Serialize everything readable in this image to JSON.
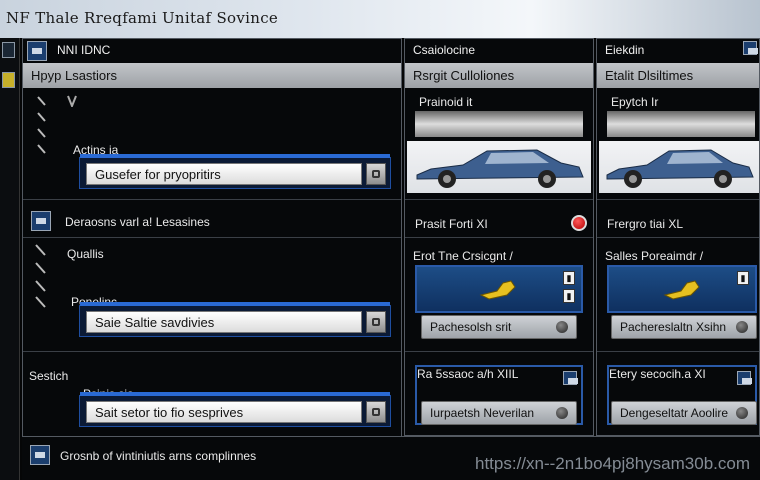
{
  "window": {
    "title": "NF Thale Rreqfami Unitaf Sovince"
  },
  "left_panel": {
    "header": "NNI IDNC",
    "subheader": "Hpyp Lsastiors",
    "section1": {
      "label": "Actins ia",
      "input_value": "Gusefer for pryopritirs"
    },
    "section2": {
      "label": "Deraosns varl a! Lesasines"
    },
    "section3": {
      "label": "Quallis",
      "sublabel": "Ponelinc",
      "input_value": "Saie Saltie savdivies"
    },
    "section4": {
      "label": "Sestich",
      "sublabel": "Psinis sia",
      "input_value": "Sait setor tio fio sesprives"
    },
    "footer": "Grosnb of vintiniutis arns complinnes"
  },
  "mid_panel": {
    "header": "Csaiolocine",
    "subheader": "Rsrgit Culloliones",
    "car_label": "Prainoid it",
    "row2_label": "Prasit Forti XI",
    "row3_label": "Erot Tne Crsicgnt /",
    "pill1": "Pachesolsh srit",
    "row4_label": "Ra 5ssaoc a/h XIIL",
    "pill2": "Iurpaetsh Neverilan"
  },
  "right_panel": {
    "header": "Eiekdin",
    "subheader": "Etalit Dlsiltimes",
    "car_label": "Epytch Ir",
    "row2_label": "Frergro tiai XL",
    "row3_label": "Salles Poreaimdr /",
    "pill1": "Pachereslaltn Xsihn",
    "row4_label": "Etery secocih.a XI",
    "pill2": "Dengeseltatr Aoolire"
  },
  "watermark": "https://xn--2n1bo4pj8hysam30b.com",
  "icons": [
    "chevron-down-icon",
    "car-image",
    "key-icon",
    "red-status-dot",
    "window-icon"
  ],
  "colors": {
    "accent_blue": "#2a6ad4",
    "tile_blue": "#1d4d86",
    "status_red": "#e02020",
    "key_yellow": "#e6c020"
  }
}
